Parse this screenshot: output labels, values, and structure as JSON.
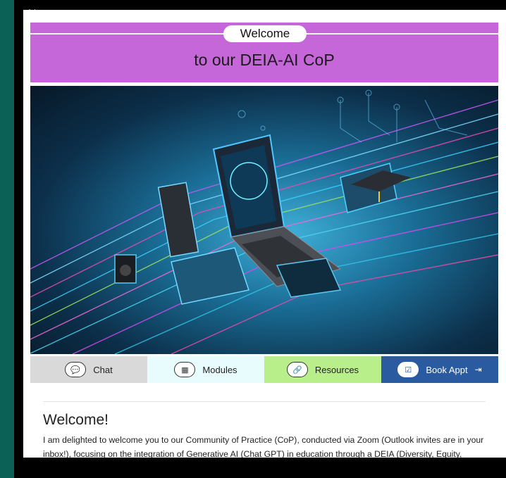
{
  "banner": {
    "pill": "Welcome",
    "title": "to our DEIA-AI CoP"
  },
  "nav": [
    {
      "label": "Chat",
      "icon": "chat-bubble-icon",
      "color": "#d9d9d9"
    },
    {
      "label": "Modules",
      "icon": "modules-icon",
      "color": "#e8fcfd"
    },
    {
      "label": "Resources",
      "icon": "link-icon",
      "color": "#b8ef8a"
    },
    {
      "label": "Book Appt",
      "icon": "calendar-check-icon",
      "color": "#2a5aa0"
    }
  ],
  "content": {
    "heading": "Welcome!",
    "body": "I am delighted to welcome you to our Community of Practice (CoP), conducted via Zoom (Outlook invites are in your inbox!), focusing on the integration of Generative AI (Chat GPT) in education through a DEIA (Diversity, Equity, Inclusion, and Accessibility) lens. Our CoP will explore the practical, ethical, and innovative use of"
  },
  "colors": {
    "frame": "#0b6155",
    "banner": "#c566d9"
  }
}
